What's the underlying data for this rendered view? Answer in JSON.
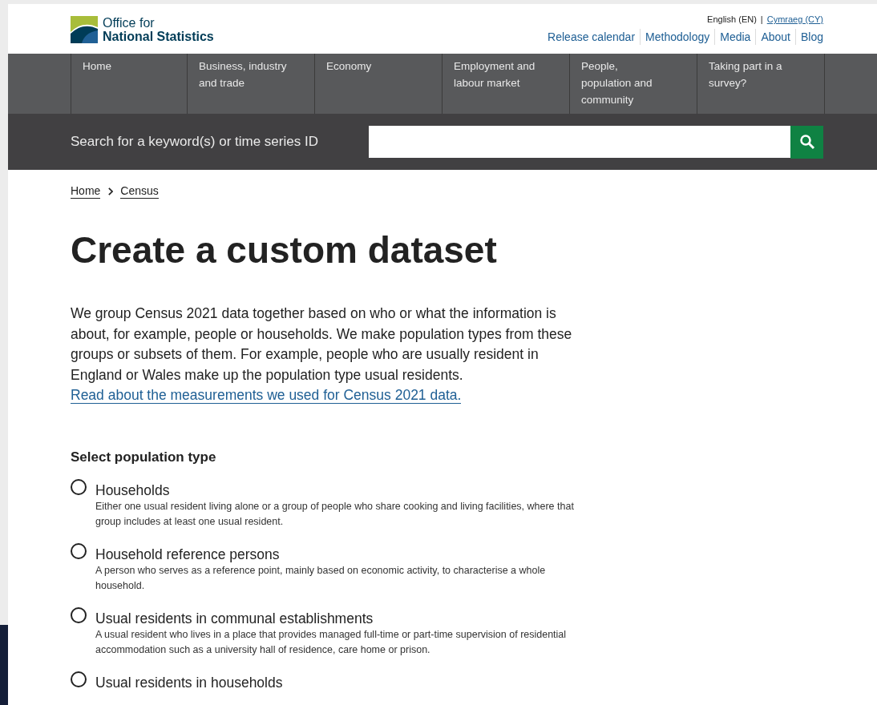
{
  "header": {
    "logo_lines": [
      "Office for",
      "National Statistics"
    ],
    "languages": [
      {
        "label": "English (EN)",
        "selected": true
      },
      {
        "label": "Cymraeg (CY)",
        "selected": false
      }
    ],
    "language_separator": "|",
    "links": [
      "Release calendar",
      "Methodology",
      "Media",
      "About",
      "Blog"
    ]
  },
  "nav": {
    "items": [
      "Home",
      "Business, industry and trade",
      "Economy",
      "Employment and labour market",
      "People, population and community",
      "Taking part in a survey?"
    ]
  },
  "search": {
    "label": "Search for a keyword(s) or time series ID"
  },
  "breadcrumbs": [
    "Home",
    "Census"
  ],
  "title": "Create a custom dataset",
  "intro": {
    "text": "We group Census 2021 data together based on who or what the information is about, for example, people or households. We make population types from these groups or subsets of them. For example, people who are usually resident in England or Wales make up the population type usual residents.",
    "link": "Read about the measurements we used for Census 2021 data."
  },
  "form": {
    "legend": "Select population type",
    "options": [
      {
        "label": "Households",
        "description": "Either one usual resident living alone or a group of people who share cooking and living facilities, where that group includes at least one usual resident.",
        "selected": false
      },
      {
        "label": "Household reference persons",
        "description": "A person who serves as a reference point, mainly based on economic activity, to characterise a whole household.",
        "selected": false
      },
      {
        "label": "Usual residents in communal establishments",
        "description": "A usual resident who lives in a place that provides managed full-time or part-time supervision of residential accommodation such as a university hall of residence, care home or prison.",
        "selected": false
      },
      {
        "label": "Usual residents in households",
        "selected": false
      }
    ]
  }
}
